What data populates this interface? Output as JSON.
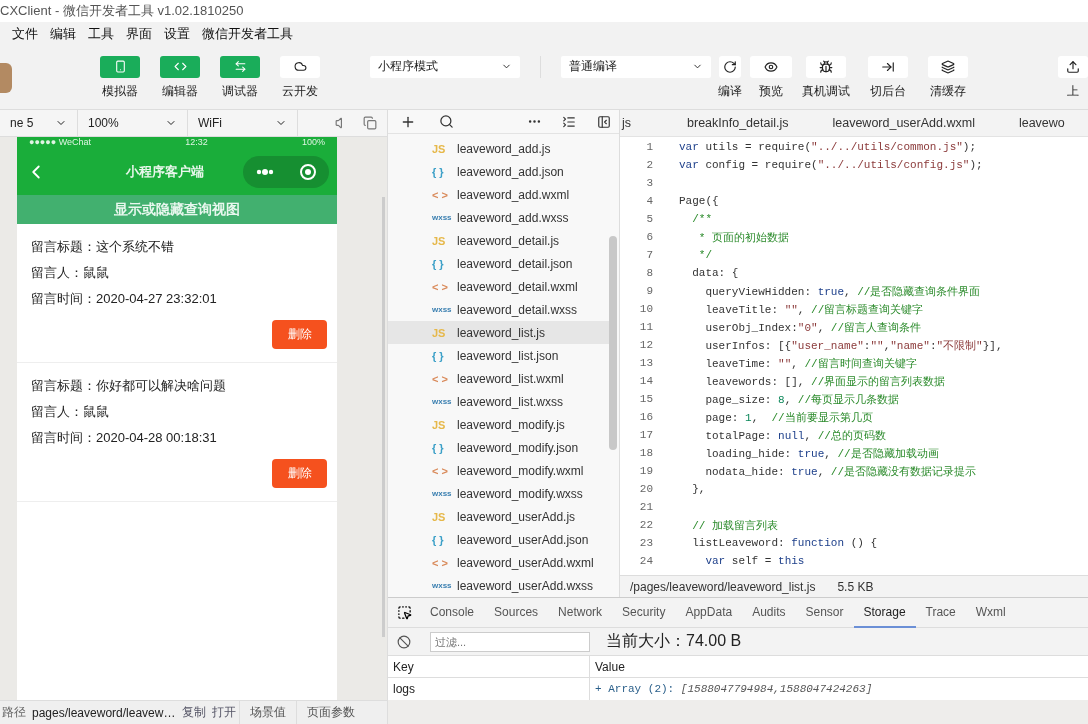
{
  "window": {
    "title": "CXClient - 微信开发者工具 v1.02.1810250"
  },
  "menu": [
    "文件",
    "编辑",
    "工具",
    "界面",
    "设置",
    "微信开发者工具"
  ],
  "toolbar": {
    "view_buttons": [
      {
        "label": "模拟器",
        "on": true
      },
      {
        "label": "编辑器",
        "on": true
      },
      {
        "label": "调试器",
        "on": true
      },
      {
        "label": "云开发",
        "on": false
      }
    ],
    "mode_select": "小程序模式",
    "compile_select": "普通编译",
    "actions": [
      "编译",
      "预览",
      "真机调试",
      "切后台",
      "清缓存",
      "上"
    ]
  },
  "simulator": {
    "device": "ne 5",
    "zoom": "100%",
    "network": "WiFi",
    "status": {
      "carrier": "●●●●● WeChat",
      "time": "12:32",
      "battery": "100%"
    },
    "nav_title": "小程序客户端",
    "banner": "显示或隐藏查询视图",
    "messages": [
      {
        "title": "留言标题：这个系统不错",
        "author": "留言人：鼠鼠",
        "time": "留言时间：2020-04-27 23:32:01",
        "delete": "删除"
      },
      {
        "title": "留言标题：你好都可以解决啥问题",
        "author": "留言人：鼠鼠",
        "time": "留言时间：2020-04-28 00:18:31",
        "delete": "删除"
      }
    ]
  },
  "status_bar": {
    "label": "路径",
    "path": "pages/leaveword/leavew…",
    "copy": "复制",
    "open": "打开",
    "scene": "场景值",
    "params": "页面参数"
  },
  "files": [
    {
      "badge": "JS",
      "kind": "js",
      "name": "leaveword_add.js",
      "selected": false
    },
    {
      "badge": "{ }",
      "kind": "json",
      "name": "leaveword_add.json",
      "selected": false
    },
    {
      "badge": "< >",
      "kind": "wxml",
      "name": "leaveword_add.wxml",
      "selected": false
    },
    {
      "badge": "wxss",
      "kind": "wxss",
      "name": "leaveword_add.wxss",
      "selected": false
    },
    {
      "badge": "JS",
      "kind": "js",
      "name": "leaveword_detail.js",
      "selected": false
    },
    {
      "badge": "{ }",
      "kind": "json",
      "name": "leaveword_detail.json",
      "selected": false
    },
    {
      "badge": "< >",
      "kind": "wxml",
      "name": "leaveword_detail.wxml",
      "selected": false
    },
    {
      "badge": "wxss",
      "kind": "wxss",
      "name": "leaveword_detail.wxss",
      "selected": false
    },
    {
      "badge": "JS",
      "kind": "js",
      "name": "leaveword_list.js",
      "selected": true
    },
    {
      "badge": "{ }",
      "kind": "json",
      "name": "leaveword_list.json",
      "selected": false
    },
    {
      "badge": "< >",
      "kind": "wxml",
      "name": "leaveword_list.wxml",
      "selected": false
    },
    {
      "badge": "wxss",
      "kind": "wxss",
      "name": "leaveword_list.wxss",
      "selected": false
    },
    {
      "badge": "JS",
      "kind": "js",
      "name": "leaveword_modify.js",
      "selected": false
    },
    {
      "badge": "{ }",
      "kind": "json",
      "name": "leaveword_modify.json",
      "selected": false
    },
    {
      "badge": "< >",
      "kind": "wxml",
      "name": "leaveword_modify.wxml",
      "selected": false
    },
    {
      "badge": "wxss",
      "kind": "wxss",
      "name": "leaveword_modify.wxss",
      "selected": false
    },
    {
      "badge": "JS",
      "kind": "js",
      "name": "leaveword_userAdd.js",
      "selected": false
    },
    {
      "badge": "{ }",
      "kind": "json",
      "name": "leaveword_userAdd.json",
      "selected": false
    },
    {
      "badge": "< >",
      "kind": "wxml",
      "name": "leaveword_userAdd.wxml",
      "selected": false
    },
    {
      "badge": "wxss",
      "kind": "wxss",
      "name": "leaveword_userAdd.wxss",
      "selected": false
    }
  ],
  "editor": {
    "tabs": [
      "js",
      "breakInfo_detail.js",
      "leaveword_userAdd.wxml",
      "leavewo"
    ],
    "lines": [
      {
        "num": "1",
        "tokens": [
          {
            "kind": "kw",
            "text": "var"
          },
          {
            "kind": "plain",
            "text": " utils = require("
          },
          {
            "kind": "str",
            "text": "\"../../utils/common.js\""
          },
          {
            "kind": "plain",
            "text": ");"
          }
        ]
      },
      {
        "num": "2",
        "tokens": [
          {
            "kind": "kw",
            "text": "var"
          },
          {
            "kind": "plain",
            "text": " config = require("
          },
          {
            "kind": "str",
            "text": "\"../../utils/config.js\""
          },
          {
            "kind": "plain",
            "text": ");"
          }
        ]
      },
      {
        "num": "3"
      },
      {
        "num": "4",
        "tokens": [
          {
            "kind": "plain",
            "text": "Page({"
          }
        ]
      },
      {
        "num": "5",
        "tokens": [
          {
            "kind": "comment",
            "text": "  /**"
          }
        ]
      },
      {
        "num": "6",
        "tokens": [
          {
            "kind": "comment",
            "text": "   * 页面的初始数据"
          }
        ]
      },
      {
        "num": "7",
        "tokens": [
          {
            "kind": "comment",
            "text": "   */"
          }
        ]
      },
      {
        "num": "8",
        "tokens": [
          {
            "kind": "plain",
            "text": "  data: {"
          }
        ]
      },
      {
        "num": "9",
        "tokens": [
          {
            "kind": "plain",
            "text": "    queryViewHidden: "
          },
          {
            "kind": "kw",
            "text": "true"
          },
          {
            "kind": "plain",
            "text": ", "
          },
          {
            "kind": "comment",
            "text": "//是否隐藏查询条件界面"
          }
        ]
      },
      {
        "num": "10",
        "tokens": [
          {
            "kind": "plain",
            "text": "    leaveTitle: "
          },
          {
            "kind": "str",
            "text": "\"\""
          },
          {
            "kind": "plain",
            "text": ", "
          },
          {
            "kind": "comment",
            "text": "//留言标题查询关键字"
          }
        ]
      },
      {
        "num": "11",
        "tokens": [
          {
            "kind": "plain",
            "text": "    userObj_Index:"
          },
          {
            "kind": "str",
            "text": "\"0\""
          },
          {
            "kind": "plain",
            "text": ", "
          },
          {
            "kind": "comment",
            "text": "//留言人查询条件"
          }
        ]
      },
      {
        "num": "12",
        "tokens": [
          {
            "kind": "plain",
            "text": "    userInfos: [{"
          },
          {
            "kind": "str",
            "text": "\"user_name\""
          },
          {
            "kind": "plain",
            "text": ":"
          },
          {
            "kind": "str",
            "text": "\"\""
          },
          {
            "kind": "plain",
            "text": ","
          },
          {
            "kind": "str",
            "text": "\"name\""
          },
          {
            "kind": "plain",
            "text": ":"
          },
          {
            "kind": "str",
            "text": "\"不限制\""
          },
          {
            "kind": "plain",
            "text": "}],"
          }
        ]
      },
      {
        "num": "13",
        "tokens": [
          {
            "kind": "plain",
            "text": "    leaveTime: "
          },
          {
            "kind": "str",
            "text": "\"\""
          },
          {
            "kind": "plain",
            "text": ", "
          },
          {
            "kind": "comment",
            "text": "//留言时间查询关键字"
          }
        ]
      },
      {
        "num": "14",
        "tokens": [
          {
            "kind": "plain",
            "text": "    leavewords: [], "
          },
          {
            "kind": "comment",
            "text": "//界面显示的留言列表数据"
          }
        ]
      },
      {
        "num": "15",
        "tokens": [
          {
            "kind": "plain",
            "text": "    page_size: "
          },
          {
            "kind": "num",
            "text": "8"
          },
          {
            "kind": "plain",
            "text": ", "
          },
          {
            "kind": "comment",
            "text": "//每页显示几条数据"
          }
        ]
      },
      {
        "num": "16",
        "tokens": [
          {
            "kind": "plain",
            "text": "    page: "
          },
          {
            "kind": "num",
            "text": "1"
          },
          {
            "kind": "plain",
            "text": ",  "
          },
          {
            "kind": "comment",
            "text": "//当前要显示第几页"
          }
        ]
      },
      {
        "num": "17",
        "tokens": [
          {
            "kind": "plain",
            "text": "    totalPage: "
          },
          {
            "kind": "kw",
            "text": "null"
          },
          {
            "kind": "plain",
            "text": ", "
          },
          {
            "kind": "comment",
            "text": "//总的页码数"
          }
        ]
      },
      {
        "num": "18",
        "tokens": [
          {
            "kind": "plain",
            "text": "    loading_hide: "
          },
          {
            "kind": "kw",
            "text": "true"
          },
          {
            "kind": "plain",
            "text": ", "
          },
          {
            "kind": "comment",
            "text": "//是否隐藏加载动画"
          }
        ]
      },
      {
        "num": "19",
        "tokens": [
          {
            "kind": "plain",
            "text": "    nodata_hide: "
          },
          {
            "kind": "kw",
            "text": "true"
          },
          {
            "kind": "plain",
            "text": ", "
          },
          {
            "kind": "comment",
            "text": "//是否隐藏没有数据记录提示"
          }
        ]
      },
      {
        "num": "20",
        "tokens": [
          {
            "kind": "plain",
            "text": "  },"
          }
        ]
      },
      {
        "num": "21"
      },
      {
        "num": "22",
        "tokens": [
          {
            "kind": "comment",
            "text": "  // 加载留言列表"
          }
        ]
      },
      {
        "num": "23",
        "tokens": [
          {
            "kind": "plain",
            "text": "  listLeaveword: "
          },
          {
            "kind": "kw",
            "text": "function"
          },
          {
            "kind": "plain",
            "text": " () {"
          }
        ]
      },
      {
        "num": "24",
        "tokens": [
          {
            "kind": "kw",
            "text": "    var"
          },
          {
            "kind": "plain",
            "text": " self = "
          },
          {
            "kind": "kw",
            "text": "this"
          }
        ]
      }
    ],
    "file_path": "/pages/leaveword/leaveword_list.js",
    "file_size": "5.5 KB"
  },
  "devtools": {
    "tabs": [
      {
        "label": "Console",
        "selected": false
      },
      {
        "label": "Sources",
        "selected": false
      },
      {
        "label": "Network",
        "selected": false
      },
      {
        "label": "Security",
        "selected": false
      },
      {
        "label": "AppData",
        "selected": false
      },
      {
        "label": "Audits",
        "selected": false
      },
      {
        "label": "Sensor",
        "selected": false
      },
      {
        "label": "Storage",
        "selected": true
      },
      {
        "label": "Trace",
        "selected": false
      },
      {
        "label": "Wxml",
        "selected": false
      }
    ],
    "filter": {
      "placeholder": "过滤..."
    },
    "size": "当前大小：74.00 B",
    "table": {
      "columns": [
        "Key",
        "Value"
      ],
      "rows": [
        {
          "key": "logs",
          "value_prefix": "+ Array (2):",
          "value": "[1588047794984,1588047424263]"
        }
      ]
    }
  }
}
